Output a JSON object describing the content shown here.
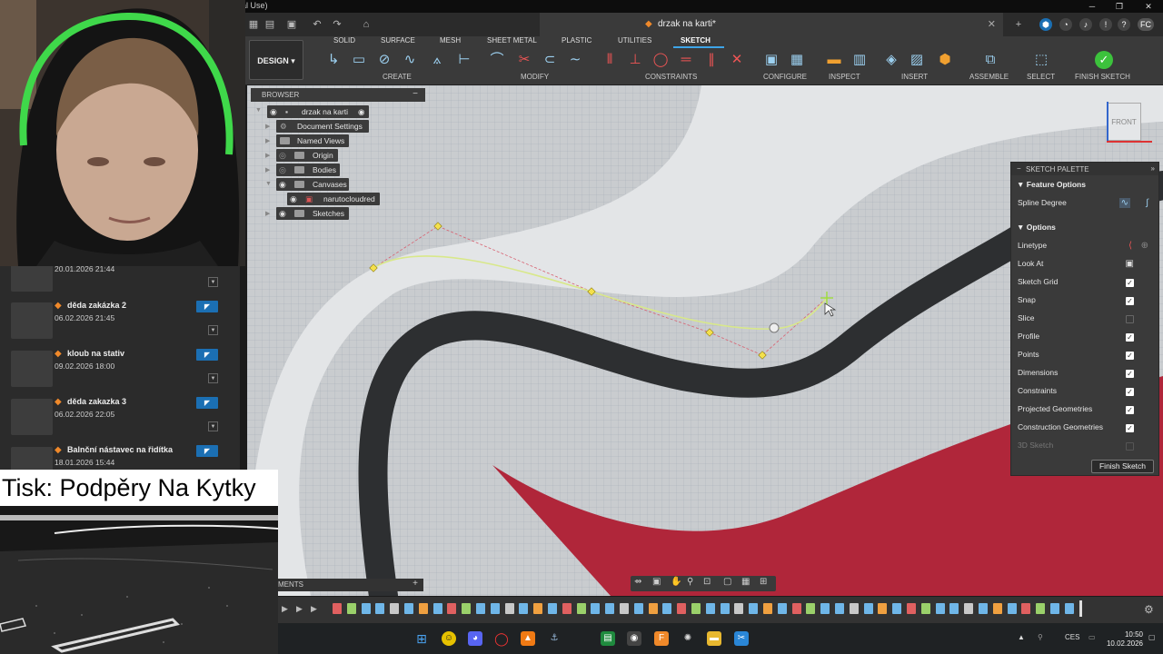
{
  "window": {
    "title": "al Use)",
    "document_tab": "drzak na karti*"
  },
  "toolbar": {
    "mode": "DESIGN",
    "workspace_tabs": [
      "SOLID",
      "SURFACE",
      "MESH",
      "SHEET METAL",
      "PLASTIC",
      "UTILITIES",
      "SKETCH"
    ],
    "active_tab": "SKETCH",
    "groups": {
      "create": "CREATE",
      "modify": "MODIFY",
      "constraints": "CONSTRAINTS",
      "configure": "CONFIGURE",
      "inspect": "INSPECT",
      "insert": "INSERT",
      "assemble": "ASSEMBLE",
      "select": "SELECT",
      "finish": "FINISH SKETCH"
    }
  },
  "browser": {
    "header": "BROWSER",
    "root": "drzak na karti",
    "nodes": [
      "Document Settings",
      "Named Views",
      "Origin",
      "Bodies",
      "Canvases",
      "narutocloudred",
      "Sketches"
    ]
  },
  "viewcube": {
    "face": "FRONT"
  },
  "palette": {
    "header": "SKETCH PALETTE",
    "feature_options": "Feature Options",
    "spline_degree": "Spline Degree",
    "options": "Options",
    "rows": [
      {
        "label": "Linetype",
        "state": "icon"
      },
      {
        "label": "Look At",
        "state": "icon"
      },
      {
        "label": "Sketch Grid",
        "state": "on"
      },
      {
        "label": "Snap",
        "state": "on"
      },
      {
        "label": "Slice",
        "state": "off"
      },
      {
        "label": "Profile",
        "state": "on"
      },
      {
        "label": "Points",
        "state": "on"
      },
      {
        "label": "Dimensions",
        "state": "on"
      },
      {
        "label": "Constraints",
        "state": "on"
      },
      {
        "label": "Projected Geometries",
        "state": "on"
      },
      {
        "label": "Construction Geometries",
        "state": "on"
      },
      {
        "label": "3D Sketch",
        "state": "disabled"
      }
    ],
    "finish_button": "Finish Sketch"
  },
  "data_panel": {
    "items": [
      {
        "name": "",
        "date": "20.01.2026 21:44"
      },
      {
        "name": "děda zakázka 2",
        "date": "06.02.2026 21:45"
      },
      {
        "name": "kloub na stativ",
        "date": "09.02.2026 18:00"
      },
      {
        "name": "děda zakazka 3",
        "date": "06.02.2026 22:05"
      },
      {
        "name": "Balnční nástavec na řidítka",
        "date": "18.01.2026 15:44"
      }
    ]
  },
  "stream": {
    "caption": "Tisk: Podpěry Na Kytky"
  },
  "comments": {
    "label": "MENTS"
  },
  "taskbar": {
    "lang": "CES",
    "time": "10:50",
    "date": "10.02.2026"
  },
  "colors": {
    "accent": "#3ea5e8",
    "finish_green": "#3cc23c",
    "canvas_red": "#b0263a",
    "spline": "#d8e88a"
  }
}
